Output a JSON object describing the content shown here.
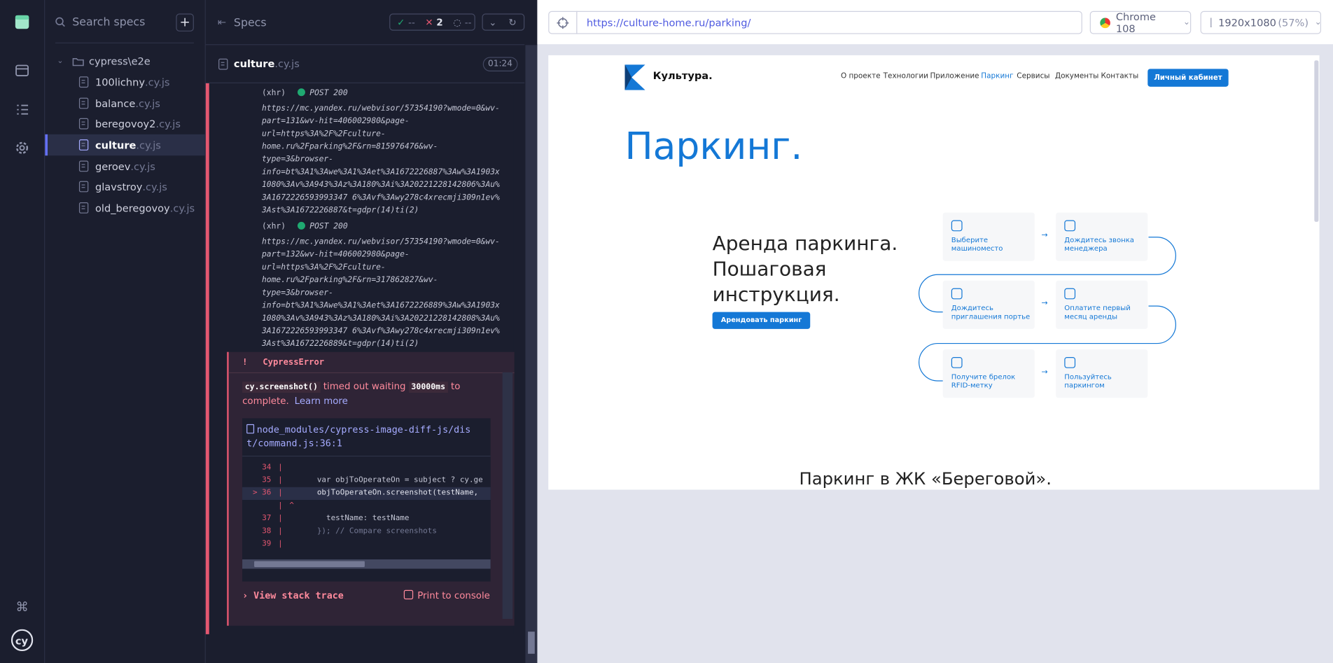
{
  "specs": {
    "search_placeholder": "Search specs",
    "add_button": "+",
    "folder": "cypress\\e2e",
    "files": [
      {
        "name": "100lichny",
        "ext": ".cy.js"
      },
      {
        "name": "balance",
        "ext": ".cy.js"
      },
      {
        "name": "beregovoy2",
        "ext": ".cy.js"
      },
      {
        "name": "culture",
        "ext": ".cy.js"
      },
      {
        "name": "geroev",
        "ext": ".cy.js"
      },
      {
        "name": "glavstroy",
        "ext": ".cy.js"
      },
      {
        "name": "old_beregovoy",
        "ext": ".cy.js"
      }
    ]
  },
  "reporter": {
    "title": "Specs",
    "passed": "--",
    "failed": "2",
    "pending": "--",
    "spec_name": "culture",
    "spec_ext": ".cy.js",
    "duration": "01:24",
    "log1": {
      "kind": "(xhr)",
      "method": "POST 200",
      "lines": [
        "https://mc.yandex.ru/webvisor/57354190?wmode=0&wv-",
        "part=131&wv-hit=406002980&page-",
        "url=https%3A%2F%2Fculture-",
        "home.ru%2Fparking%2F&rn=815976476&wv-",
        "type=3&browser-",
        "info=bt%3A1%3Awe%3A1%3Aet%3A1672226887%3Aw%3A1903x",
        "1080%3Av%3A943%3Az%3A180%3Ai%3A20221228142806%3Au%",
        "3A1672226593993347 6%3Avf%3Awy278c4xrecmji309n1ev%",
        "3Ast%3A1672226887&t=gdpr(14)ti(2)"
      ]
    },
    "log2": {
      "kind": "(xhr)",
      "method": "POST 200",
      "lines": [
        "https://mc.yandex.ru/webvisor/57354190?wmode=0&wv-",
        "part=132&wv-hit=406002980&page-",
        "url=https%3A%2F%2Fculture-",
        "home.ru%2Fparking%2F&rn=317862827&wv-",
        "type=3&browser-",
        "info=bt%3A1%3Awe%3A1%3Aet%3A1672226889%3Aw%3A1903x",
        "1080%3Av%3A943%3Az%3A180%3Ai%3A20221228142808%3Au%",
        "3A1672226593993347 6%3Avf%3Awy278c4xrecmji309n1ev%",
        "3Ast%3A1672226889&t=gdpr(14)ti(2)"
      ]
    },
    "error": {
      "mark": "!",
      "title": "CypressError",
      "cmd": "cy.screenshot()",
      "msg1": "timed out waiting",
      "ms": "30000ms",
      "msg2": "to",
      "msg3": "complete.",
      "learn_more": "Learn more",
      "file_line1": "node_modules/cypress-image-diff-js/dis",
      "file_line2": "t/command.js:36:1",
      "code": [
        {
          "num": "34",
          "text": ""
        },
        {
          "num": "35",
          "text": "      var objToOperateOn = subject ? cy.ge"
        },
        {
          "num": "> 36",
          "text": "      objToOperateOn.screenshot(testName,"
        },
        {
          "num": "",
          "text": "^"
        },
        {
          "num": "37",
          "text": "        testName: testName"
        },
        {
          "num": "38",
          "text": "      }); // Compare screenshots"
        },
        {
          "num": "39",
          "text": ""
        }
      ],
      "stack_trace": "View stack trace",
      "print_console": "Print to console"
    }
  },
  "browser": {
    "url": "https://culture-home.ru/parking/",
    "browser_name": "Chrome 108",
    "viewport": "1920x1080",
    "scale": "(57%)"
  },
  "site": {
    "logo": "Культура.",
    "menu": [
      "О проекте",
      "Технологии",
      "Приложение",
      "Паркинг",
      "Сервисы",
      "Документы",
      "Контакты"
    ],
    "cabinet": "Личный кабинет",
    "heading": "Паркинг.",
    "sub1": "Аренда паркинга.",
    "sub2": "Пошаговая",
    "sub3": "инструкция.",
    "rent_btn": "Арендовать паркинг",
    "steps": [
      "Выберите машиноместо",
      "Дождитесь звонка менеджера",
      "Дождитесь приглашения портье",
      "Оплатите первый месяц аренды",
      "Получите брелок RFID-метку",
      "Пользуйтесь паркингом"
    ],
    "footer_heading": "Паркинг в ЖК «Береговой»."
  },
  "colors": {
    "accent": "#6470f3",
    "error": "#e45770",
    "site_blue": "#1478d6"
  }
}
